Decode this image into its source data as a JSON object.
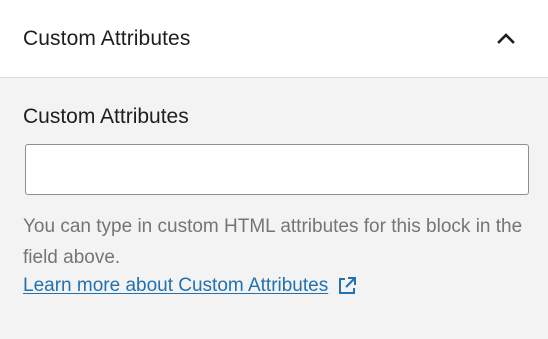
{
  "header": {
    "title": "Custom Attributes",
    "toggle_icon": "chevron-up-icon"
  },
  "field": {
    "label": "Custom Attributes",
    "value": "",
    "placeholder": ""
  },
  "help": {
    "text": "You can type in custom HTML attributes for this block in the field above.",
    "link_text": "Learn more about Custom Attributes",
    "link_icon": "external-link-icon"
  },
  "colors": {
    "header_bg": "#ffffff",
    "body_bg": "#f3f3f3",
    "link": "#2271b1",
    "help_text": "#757575"
  }
}
